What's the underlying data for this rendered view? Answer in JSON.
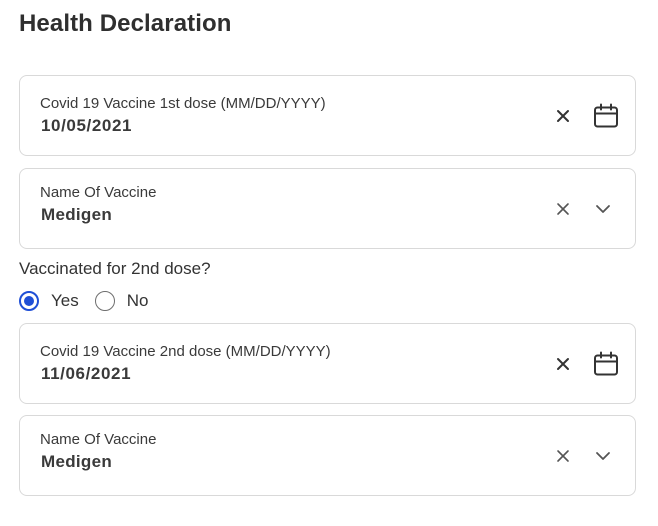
{
  "page": {
    "title": "Health Declaration"
  },
  "dose1": {
    "label": "Covid 19 Vaccine 1st dose (MM/DD/YYYY)",
    "value": "10/05/2021"
  },
  "vaccine1": {
    "label": "Name Of Vaccine",
    "value": "Medigen"
  },
  "second_dose_question": {
    "text": "Vaccinated for 2nd dose?",
    "options": [
      {
        "label": "Yes",
        "selected": true
      },
      {
        "label": "No",
        "selected": false
      }
    ]
  },
  "dose2": {
    "label": "Covid 19 Vaccine 2nd dose (MM/DD/YYYY)",
    "value": "11/06/2021"
  },
  "vaccine2": {
    "label": "Name Of Vaccine",
    "value": "Medigen"
  },
  "icons": {
    "clear": "close-icon",
    "calendar": "calendar-icon",
    "dropdown": "chevron-down-icon"
  },
  "colors": {
    "accent": "#1f4fd6",
    "border": "#d9d9d9",
    "text": "#3a3a3a"
  }
}
